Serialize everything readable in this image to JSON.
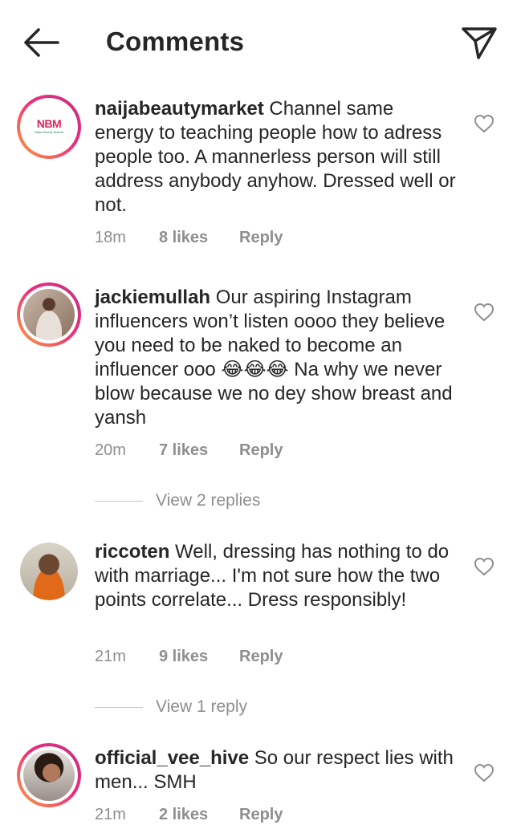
{
  "header": {
    "title": "Comments",
    "back_icon": "arrow-left-icon",
    "share_icon": "paper-plane-icon"
  },
  "comments": [
    {
      "username": "naijabeautymarket",
      "body": " Channel same energy to teaching people how to adress people too. A mannerless person will still address anybody anyhow. Dressed well or not.",
      "time": "18m",
      "likes": "8 likes",
      "reply": "Reply",
      "avatar_logo": "NBM",
      "avatar_tagline": "Naija Beauty Market"
    },
    {
      "username": "jackiemullah",
      "body": " Our aspiring Instagram influencers won’t listen oooo they believe you need to be naked to become an influencer ooo 😂😂😂 Na why we never blow because we no dey show breast and yansh",
      "time": "20m",
      "likes": "7 likes",
      "reply": "Reply",
      "view_replies": "View 2 replies"
    },
    {
      "username": "riccoten",
      "body": " Well, dressing has nothing to do with marriage... I'm not sure how the two points correlate... Dress responsibly!",
      "time": "21m",
      "likes": "9 likes",
      "reply": "Reply",
      "view_replies": "View 1 reply"
    },
    {
      "username": "official_vee_hive",
      "body": " So our respect lies with men... SMH",
      "time": "21m",
      "likes": "2 likes",
      "reply": "Reply"
    }
  ],
  "colors": {
    "text": "#262626",
    "meta": "#8e8e8e",
    "ring_start": "#f9a33f",
    "ring_end": "#c13584"
  }
}
